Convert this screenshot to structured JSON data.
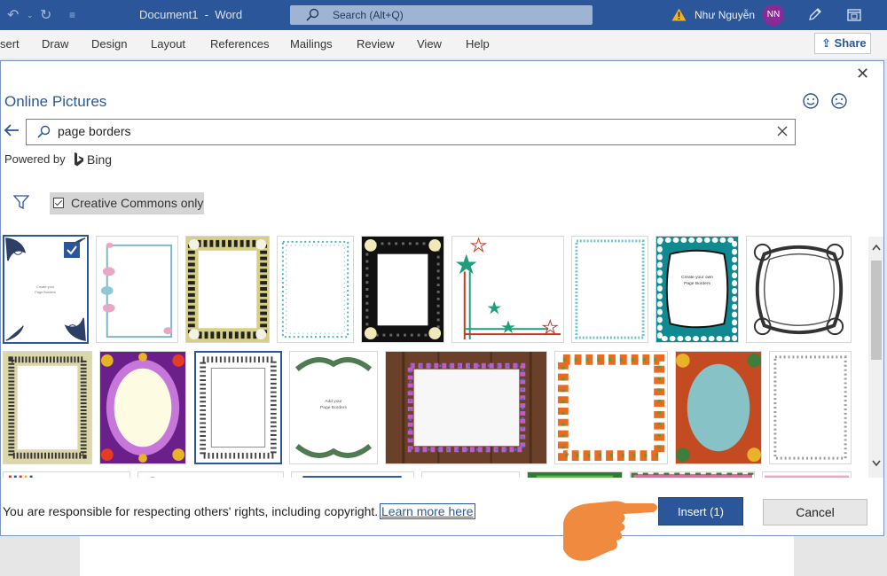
{
  "app": {
    "document_title": "Document1",
    "app_name": "Word",
    "title_separator": "-",
    "search_placeholder": "Search (Alt+Q)",
    "user_name": "Như Nguyễn",
    "user_initials": "NN",
    "brand_color": "#2b579a"
  },
  "ribbon": {
    "tabs": [
      "sert",
      "Draw",
      "Design",
      "Layout",
      "References",
      "Mailings",
      "Review",
      "View",
      "Help"
    ],
    "share_label": "Share"
  },
  "dialog": {
    "title": "Online Pictures",
    "search_value": "page borders",
    "powered_by": "Powered by",
    "bing_label": "Bing",
    "filter_label": "Creative Commons only",
    "rights_text": "You are responsible for respecting others' rights, including copyright.",
    "learn_more": "Learn more here",
    "insert_label": "Insert (1)",
    "cancel_label": "Cancel"
  },
  "results": {
    "selected_count": 1,
    "thumb_texts": {
      "t1_line1": "Create your",
      "t1_line2": "Page Borders",
      "t8_line1": "Create your own",
      "t8_line2": "Page Borders",
      "t13_line1": "Add your",
      "t13_line2": "Page Borders"
    },
    "items": [
      {
        "name": "floral corner border",
        "selected": true
      },
      {
        "name": "pink birds blue frame border"
      },
      {
        "name": "white daisy border"
      },
      {
        "name": "teal dotted border"
      },
      {
        "name": "black daisy frame border"
      },
      {
        "name": "stars corner border"
      },
      {
        "name": "dotted light teal border"
      },
      {
        "name": "teal polka dot border"
      },
      {
        "name": "ornate black swirl frame"
      },
      {
        "name": "black lace border"
      },
      {
        "name": "sunflower purple glow border"
      },
      {
        "name": "blue lace border"
      },
      {
        "name": "green leaf swag border"
      },
      {
        "name": "flowers on wood border"
      },
      {
        "name": "orange flower border"
      },
      {
        "name": "autumn flowers teal border"
      },
      {
        "name": "dotted silver border"
      }
    ]
  }
}
